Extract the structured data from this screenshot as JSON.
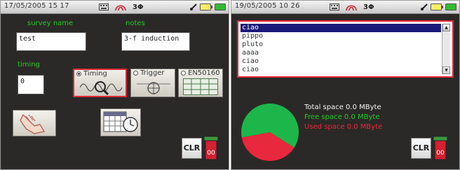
{
  "screen1": {
    "status": {
      "datetime": "17/05/2005 15 17",
      "phase": "3Φ"
    },
    "survey_name": {
      "label": "survey  name",
      "value": "test"
    },
    "notes": {
      "label": "notes",
      "value": "3-f induction"
    },
    "timing": {
      "label": "timing",
      "value": "0"
    },
    "modes": [
      {
        "label": "Timing",
        "selected": true
      },
      {
        "label": "Trigger",
        "selected": false
      },
      {
        "label": "EN50160",
        "selected": false
      }
    ],
    "clr_label": "CLR"
  },
  "screen2": {
    "status": {
      "datetime": "19/05/2005 10 26",
      "phase": "3Φ"
    },
    "list_items": [
      "ciao",
      "pippo",
      "pluto",
      "aaaa",
      "ciao",
      "ciao"
    ],
    "selected_index": 0,
    "total_space": "Total space 0.0 MByte",
    "free_space": "Free space 0.0 MByte",
    "used_space": "Used space 0.0 MByte",
    "pie": {
      "free_fraction": 0.62,
      "used_fraction": 0.38
    },
    "clr_label": "CLR"
  },
  "colors": {
    "accent": "#e0283a",
    "label_green": "#22cc22",
    "free": "#1db64a",
    "used": "#e8283c",
    "background": "#2b2927"
  }
}
